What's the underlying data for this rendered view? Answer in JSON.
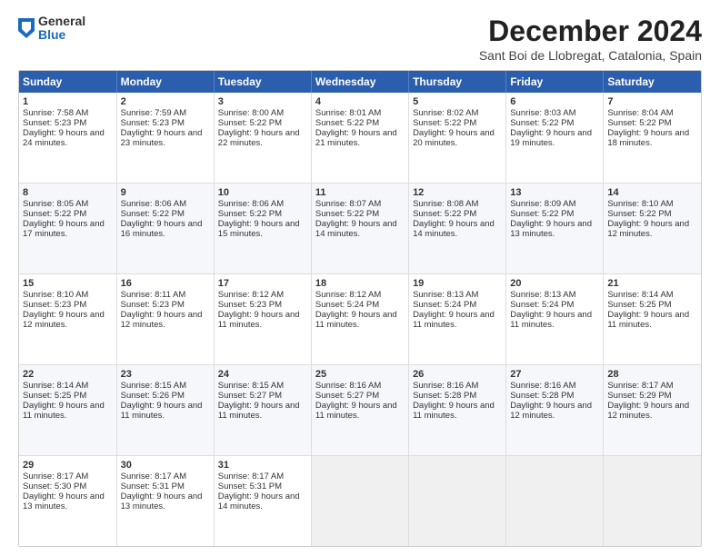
{
  "logo": {
    "general": "General",
    "blue": "Blue"
  },
  "header": {
    "month": "December 2024",
    "location": "Sant Boi de Llobregat, Catalonia, Spain"
  },
  "weekdays": [
    "Sunday",
    "Monday",
    "Tuesday",
    "Wednesday",
    "Thursday",
    "Friday",
    "Saturday"
  ],
  "weeks": [
    [
      {
        "day": "1",
        "sunrise": "7:58 AM",
        "sunset": "5:23 PM",
        "daylight": "9 hours and 24 minutes."
      },
      {
        "day": "2",
        "sunrise": "7:59 AM",
        "sunset": "5:23 PM",
        "daylight": "9 hours and 23 minutes."
      },
      {
        "day": "3",
        "sunrise": "8:00 AM",
        "sunset": "5:22 PM",
        "daylight": "9 hours and 22 minutes."
      },
      {
        "day": "4",
        "sunrise": "8:01 AM",
        "sunset": "5:22 PM",
        "daylight": "9 hours and 21 minutes."
      },
      {
        "day": "5",
        "sunrise": "8:02 AM",
        "sunset": "5:22 PM",
        "daylight": "9 hours and 20 minutes."
      },
      {
        "day": "6",
        "sunrise": "8:03 AM",
        "sunset": "5:22 PM",
        "daylight": "9 hours and 19 minutes."
      },
      {
        "day": "7",
        "sunrise": "8:04 AM",
        "sunset": "5:22 PM",
        "daylight": "9 hours and 18 minutes."
      }
    ],
    [
      {
        "day": "8",
        "sunrise": "8:05 AM",
        "sunset": "5:22 PM",
        "daylight": "9 hours and 17 minutes."
      },
      {
        "day": "9",
        "sunrise": "8:06 AM",
        "sunset": "5:22 PM",
        "daylight": "9 hours and 16 minutes."
      },
      {
        "day": "10",
        "sunrise": "8:06 AM",
        "sunset": "5:22 PM",
        "daylight": "9 hours and 15 minutes."
      },
      {
        "day": "11",
        "sunrise": "8:07 AM",
        "sunset": "5:22 PM",
        "daylight": "9 hours and 14 minutes."
      },
      {
        "day": "12",
        "sunrise": "8:08 AM",
        "sunset": "5:22 PM",
        "daylight": "9 hours and 14 minutes."
      },
      {
        "day": "13",
        "sunrise": "8:09 AM",
        "sunset": "5:22 PM",
        "daylight": "9 hours and 13 minutes."
      },
      {
        "day": "14",
        "sunrise": "8:10 AM",
        "sunset": "5:22 PM",
        "daylight": "9 hours and 12 minutes."
      }
    ],
    [
      {
        "day": "15",
        "sunrise": "8:10 AM",
        "sunset": "5:23 PM",
        "daylight": "9 hours and 12 minutes."
      },
      {
        "day": "16",
        "sunrise": "8:11 AM",
        "sunset": "5:23 PM",
        "daylight": "9 hours and 12 minutes."
      },
      {
        "day": "17",
        "sunrise": "8:12 AM",
        "sunset": "5:23 PM",
        "daylight": "9 hours and 11 minutes."
      },
      {
        "day": "18",
        "sunrise": "8:12 AM",
        "sunset": "5:24 PM",
        "daylight": "9 hours and 11 minutes."
      },
      {
        "day": "19",
        "sunrise": "8:13 AM",
        "sunset": "5:24 PM",
        "daylight": "9 hours and 11 minutes."
      },
      {
        "day": "20",
        "sunrise": "8:13 AM",
        "sunset": "5:24 PM",
        "daylight": "9 hours and 11 minutes."
      },
      {
        "day": "21",
        "sunrise": "8:14 AM",
        "sunset": "5:25 PM",
        "daylight": "9 hours and 11 minutes."
      }
    ],
    [
      {
        "day": "22",
        "sunrise": "8:14 AM",
        "sunset": "5:25 PM",
        "daylight": "9 hours and 11 minutes."
      },
      {
        "day": "23",
        "sunrise": "8:15 AM",
        "sunset": "5:26 PM",
        "daylight": "9 hours and 11 minutes."
      },
      {
        "day": "24",
        "sunrise": "8:15 AM",
        "sunset": "5:27 PM",
        "daylight": "9 hours and 11 minutes."
      },
      {
        "day": "25",
        "sunrise": "8:16 AM",
        "sunset": "5:27 PM",
        "daylight": "9 hours and 11 minutes."
      },
      {
        "day": "26",
        "sunrise": "8:16 AM",
        "sunset": "5:28 PM",
        "daylight": "9 hours and 11 minutes."
      },
      {
        "day": "27",
        "sunrise": "8:16 AM",
        "sunset": "5:28 PM",
        "daylight": "9 hours and 12 minutes."
      },
      {
        "day": "28",
        "sunrise": "8:17 AM",
        "sunset": "5:29 PM",
        "daylight": "9 hours and 12 minutes."
      }
    ],
    [
      {
        "day": "29",
        "sunrise": "8:17 AM",
        "sunset": "5:30 PM",
        "daylight": "9 hours and 13 minutes."
      },
      {
        "day": "30",
        "sunrise": "8:17 AM",
        "sunset": "5:31 PM",
        "daylight": "9 hours and 13 minutes."
      },
      {
        "day": "31",
        "sunrise": "8:17 AM",
        "sunset": "5:31 PM",
        "daylight": "9 hours and 14 minutes."
      },
      null,
      null,
      null,
      null
    ]
  ],
  "labels": {
    "sunrise": "Sunrise:",
    "sunset": "Sunset:",
    "daylight": "Daylight:"
  }
}
